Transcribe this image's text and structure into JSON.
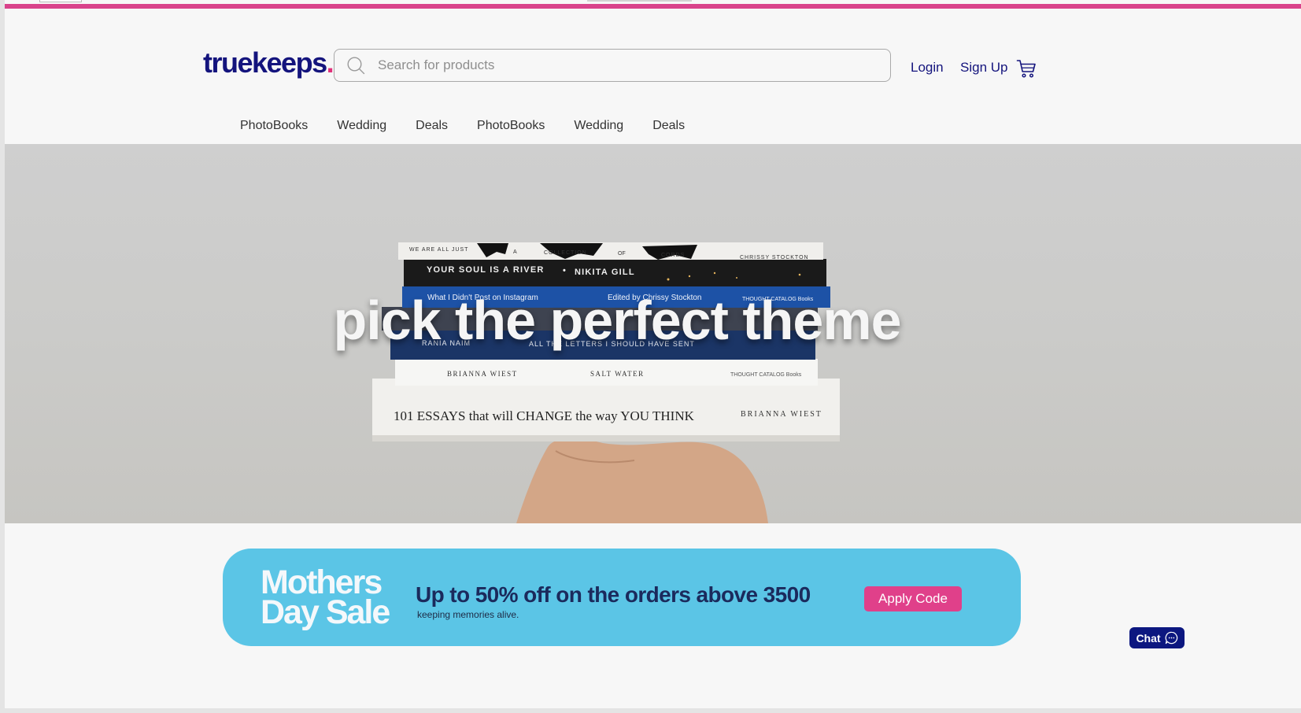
{
  "brand": {
    "name": "truekeeps",
    "dot": ".",
    "accent": "#e0317a",
    "primary": "#14147d"
  },
  "search": {
    "placeholder": "Search for products",
    "icon": "search-icon"
  },
  "header": {
    "login_label": "Login",
    "signup_label": "Sign Up",
    "cart_icon": "cart-icon"
  },
  "nav": {
    "items": [
      {
        "label": "PhotoBooks"
      },
      {
        "label": "Wedding"
      },
      {
        "label": "Deals"
      },
      {
        "label": "PhotoBooks"
      },
      {
        "label": "Wedding"
      },
      {
        "label": "Deals"
      }
    ]
  },
  "hero": {
    "title": "pick the perfect theme",
    "books": [
      {
        "texts": [
          "WE ARE ALL JUST",
          "A",
          "COLLECTION",
          "OF",
          "CORDS",
          "CHRISSY STOCKTON"
        ]
      },
      {
        "texts": [
          "YOUR SOUL IS A RIVER",
          "•",
          "NIKITA GILL"
        ]
      },
      {
        "texts": [
          "What I Didn't Post on Instagram",
          "Edited by Chrissy Stockton",
          "THOUGHT CATALOG Books"
        ]
      },
      {
        "texts": [
          "RANIA NAIM",
          "ALL THE LETTERS I SHOULD HAVE SENT"
        ]
      },
      {
        "texts": [
          "BRIANNA WIEST",
          "SALT WATER",
          "THOUGHT CATALOG Books"
        ]
      },
      {
        "texts": [
          "101 ESSAYS that will CHANGE the way YOU THINK",
          "BRIANNA WIEST"
        ]
      }
    ]
  },
  "promo": {
    "title_line1": "Mothers",
    "title_line2": "Day Sale",
    "headline": "Up to 50% off on the orders above 3500",
    "subtext": "keeping memories alive.",
    "button_label": "Apply Code",
    "background": "#5bc5e6",
    "button_color": "#e0408a"
  },
  "chat": {
    "label": "Chat",
    "icon": "chat-bubble-icon",
    "color": "#0c1780"
  },
  "colors": {
    "top_stripe": "#d9438b"
  }
}
